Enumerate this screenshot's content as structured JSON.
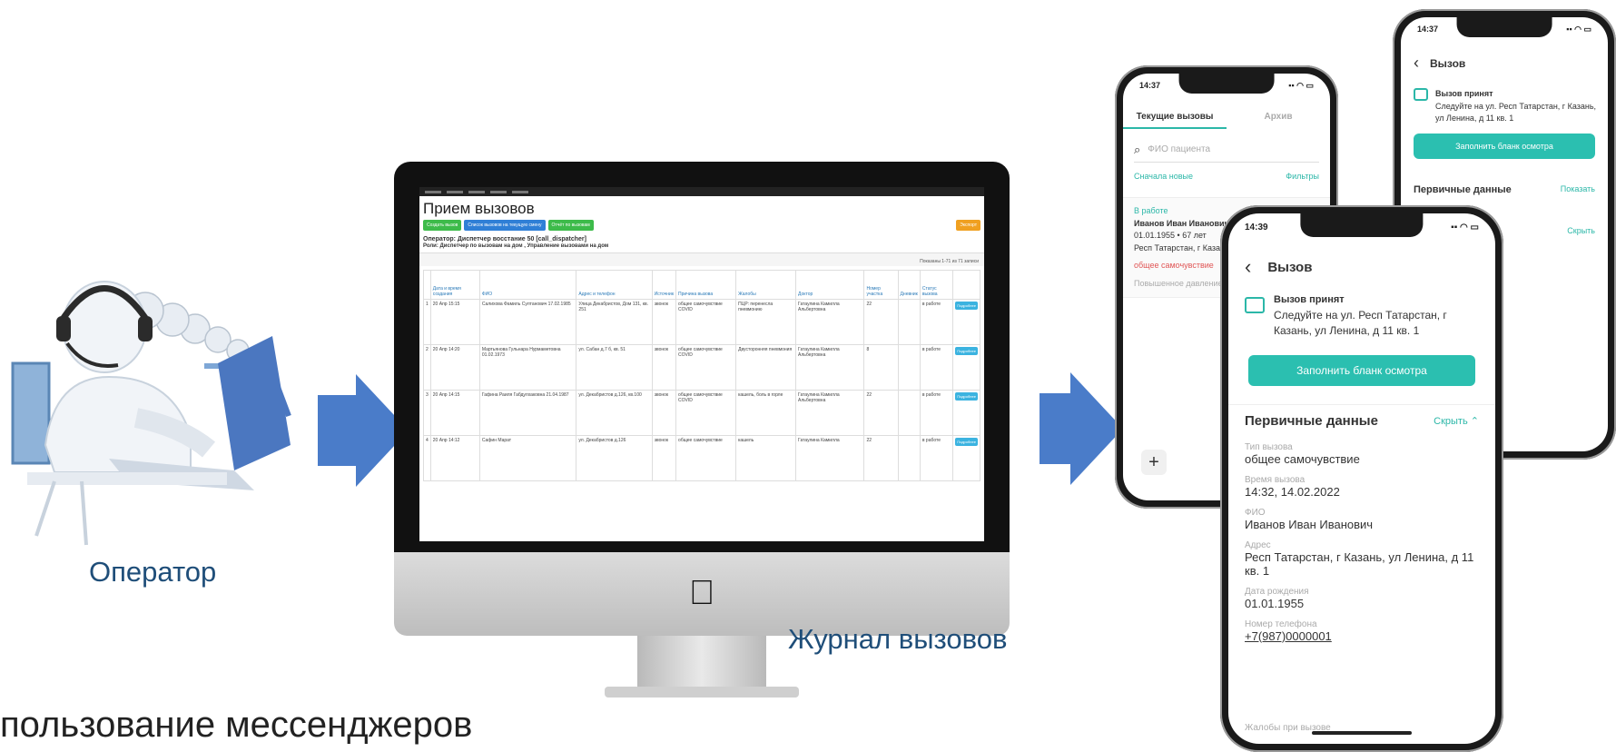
{
  "operator": {
    "label": "Оператор"
  },
  "journal": {
    "label": "Журнал вызовов"
  },
  "footer_text": "пользование мессенджеров",
  "web": {
    "title": "Прием вызовов",
    "buttons": [
      {
        "label": "Создать вызов",
        "color": "#3dbb4a"
      },
      {
        "label": "Список вызовов на текущую смену",
        "color": "#2f7fd6"
      },
      {
        "label": "Отчёт по вызовам",
        "color": "#3dbb4a"
      },
      {
        "label": "Экспорт",
        "color": "#f0a020"
      }
    ],
    "operator_line": "Оператор: Диспетчер восстание 50 [call_dispatcher]",
    "role_line": "Роли: Диспетчер по вызовам на дом , Управление вызовами на дом",
    "shown": "Показаны 1-71 из 71 записи",
    "columns": [
      "Дата и время создания",
      "ФИО",
      "Адрес и телефон",
      "Источник",
      "Причина вызова",
      "Жалобы",
      "Доктор",
      "Номер участка",
      "Дневник",
      "Статус вызова",
      ""
    ],
    "rows": [
      {
        "n": "1",
        "date": "20 Апр 15:15",
        "fio": "Салихова Фамиль Султанович 17.02.1985",
        "addr": "Улица Декабристов, Дом 131, кв. 251",
        "src": "звонок",
        "reason": "общее самочувствие COVID",
        "complaints": "ПЦР: перенесла пневмонию",
        "doctor": "Гатаулина Камилла Альбертовна",
        "area": "22",
        "diary": "",
        "status": "в работе",
        "action": "Подробнее"
      },
      {
        "n": "2",
        "date": "20 Апр 14:20",
        "fio": "Мартьянова Гульнара Нурмаметовна 01.02.1973",
        "addr": "ул. Сабан д.7 б, кв. 51",
        "src": "звонок",
        "reason": "общее самочувствие COVID",
        "complaints": "Двусторонняя пневмония",
        "doctor": "Гатаулина Камилла Альбертовна",
        "area": "8",
        "diary": "",
        "status": "в работе",
        "action": "Подробнее"
      },
      {
        "n": "3",
        "date": "20 Апр 14:15",
        "fio": "Гафина Раиля Габдулхаковна 21.04.1987",
        "addr": "ул. Декабристов д.126, кв.100",
        "src": "звонок",
        "reason": "общее самочувствие COVID",
        "complaints": "кашель, боль в горле",
        "doctor": "Гатаулина Камилла Альбертовна",
        "area": "22",
        "diary": "",
        "status": "в работе",
        "action": "Подробнее"
      },
      {
        "n": "4",
        "date": "20 Апр 14:12",
        "fio": "Сафин Марат",
        "addr": "ул. Декабристов д.126",
        "src": "звонок",
        "reason": "общее самочувствие",
        "complaints": "кашель",
        "doctor": "Гатаулина Камилла",
        "area": "22",
        "diary": "",
        "status": "в работе",
        "action": "Подробнее"
      }
    ]
  },
  "phone1": {
    "time": "14:37",
    "tabs": [
      "Текущие вызовы",
      "Архив"
    ],
    "search_placeholder": "ФИО пациента",
    "sort": "Сначала новые",
    "filters": "Фильтры",
    "status": "В работе",
    "patient": "Иванов Иван Иванович",
    "meta": "01.01.1955 • 67 лет",
    "addr": "Респ Татарстан, г Казань, ул Ленина, д 11 кв. 1",
    "extra": "общее самочувствие",
    "extra2": "Повышенное давление"
  },
  "phone2": {
    "time": "14:37",
    "back": "‹",
    "title": "Вызов",
    "accepted": "Вызов принят",
    "follow": "Следуйте на ул. Респ Татарстан, г Казань, ул Ленина, д 11 кв. 1",
    "btn": "Заполнить бланк осмотра",
    "primary": "Первичные данные",
    "show": "Показать",
    "hide": "Скрыть"
  },
  "phone3": {
    "time": "14:39",
    "back": "‹",
    "title": "Вызов",
    "accepted": "Вызов принят",
    "follow": "Следуйте на ул. Респ Татарстан, г Казань, ул Ленина, д 11 кв. 1",
    "btn": "Заполнить бланк осмотра",
    "primary": "Первичные данные",
    "hide": "Скрыть",
    "fields": [
      {
        "label": "Тип вызова",
        "value": "общее самочувствие"
      },
      {
        "label": "Время вызова",
        "value": "14:32, 14.02.2022"
      },
      {
        "label": "ФИО",
        "value": "Иванов Иван Иванович"
      },
      {
        "label": "Адрес",
        "value": "Респ Татарстан, г Казань, ул Ленина, д 11 кв. 1"
      },
      {
        "label": "Дата рождения",
        "value": "01.01.1955"
      },
      {
        "label": "Номер телефона",
        "value": "+7(987)0000001"
      }
    ],
    "last_label": "Жалобы при вызове"
  }
}
